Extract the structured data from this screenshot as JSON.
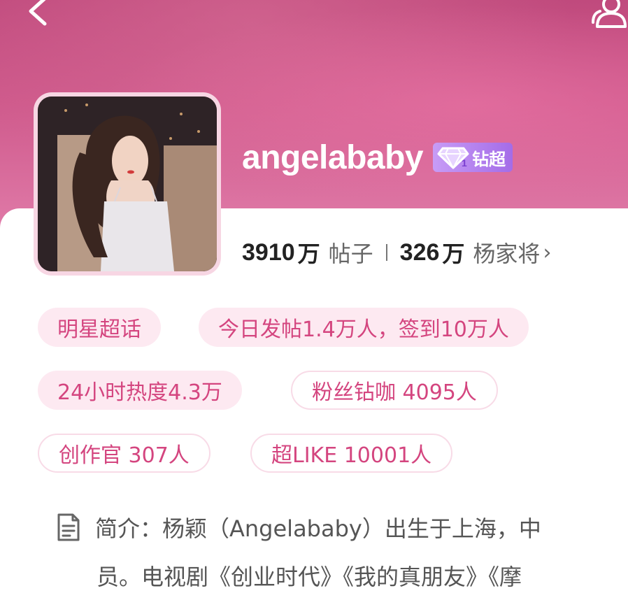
{
  "profile": {
    "username": "angelababy",
    "rank_badge": "钻超",
    "rank_level": "1",
    "stats": {
      "posts_count": "3910",
      "posts_unit": "万",
      "posts_label": "帖子",
      "fans_count": "326",
      "fans_unit": "万",
      "fans_label": "杨家将",
      "chevron": "›"
    }
  },
  "tags": [
    "明星超话",
    "今日发帖1.4万人，签到10万人",
    "24小时热度4.3万",
    "粉丝钻咖 4095人",
    "创作官 307人",
    "超LIKE 10001人"
  ],
  "description": {
    "line1": "简介：杨颖（Angelababy）出生于上海，中",
    "line2": "员。电视剧《创业时代》《我的真朋友》《摩"
  },
  "icons": {
    "back": "back-arrow-icon",
    "members": "members-icon",
    "diamond": "diamond-icon",
    "document": "document-icon"
  },
  "colors": {
    "accent": "#d4457f",
    "tag_fill": "#fde9f1",
    "badge": "#b07cf0",
    "header": "#c04a7d"
  }
}
